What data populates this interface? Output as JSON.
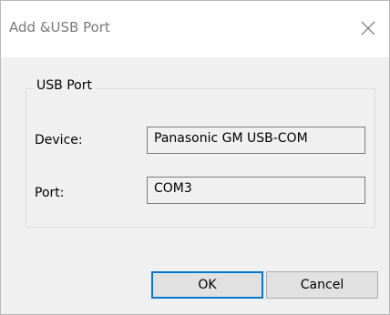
{
  "window": {
    "title": "Add &USB Port",
    "close_icon": "close-icon"
  },
  "group": {
    "legend": "USB Port",
    "device_label": "Device:",
    "device_value": "Panasonic GM USB-COM",
    "port_label": "Port:",
    "port_value": "COM3"
  },
  "buttons": {
    "ok_label": "OK",
    "cancel_label": "Cancel"
  },
  "colors": {
    "dialog_bg": "#f0f0f0",
    "titlebar_bg": "#ffffff",
    "default_button_border": "#0078d7"
  }
}
